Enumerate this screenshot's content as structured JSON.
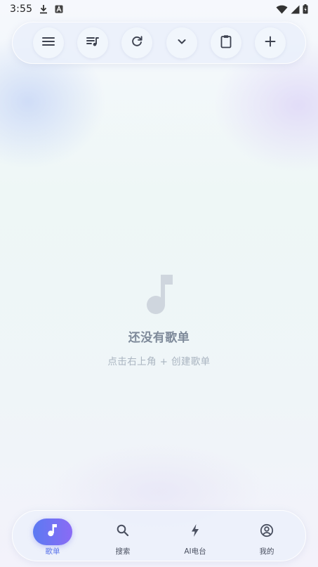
{
  "status_bar": {
    "time": "3:55",
    "icons": [
      "download-icon",
      "a-badge-icon",
      "wifi-icon",
      "signal-icon",
      "battery-icon"
    ]
  },
  "toolbar": {
    "buttons": [
      {
        "name": "menu-icon"
      },
      {
        "name": "playlist-music-icon"
      },
      {
        "name": "refresh-icon"
      },
      {
        "name": "chevron-down-icon"
      },
      {
        "name": "clipboard-icon"
      },
      {
        "name": "add-icon"
      }
    ]
  },
  "empty_state": {
    "icon": "music-note-icon",
    "title": "还没有歌单",
    "hint": "点击右上角 + 创建歌单"
  },
  "bottom_nav": {
    "active_index": 0,
    "accent_color": "#5b74ea",
    "items": [
      {
        "label": "歌单",
        "icon": "music-note-icon"
      },
      {
        "label": "搜索",
        "icon": "search-icon"
      },
      {
        "label": "AI电台",
        "icon": "bolt-icon"
      },
      {
        "label": "我的",
        "icon": "account-circle-icon"
      }
    ]
  }
}
